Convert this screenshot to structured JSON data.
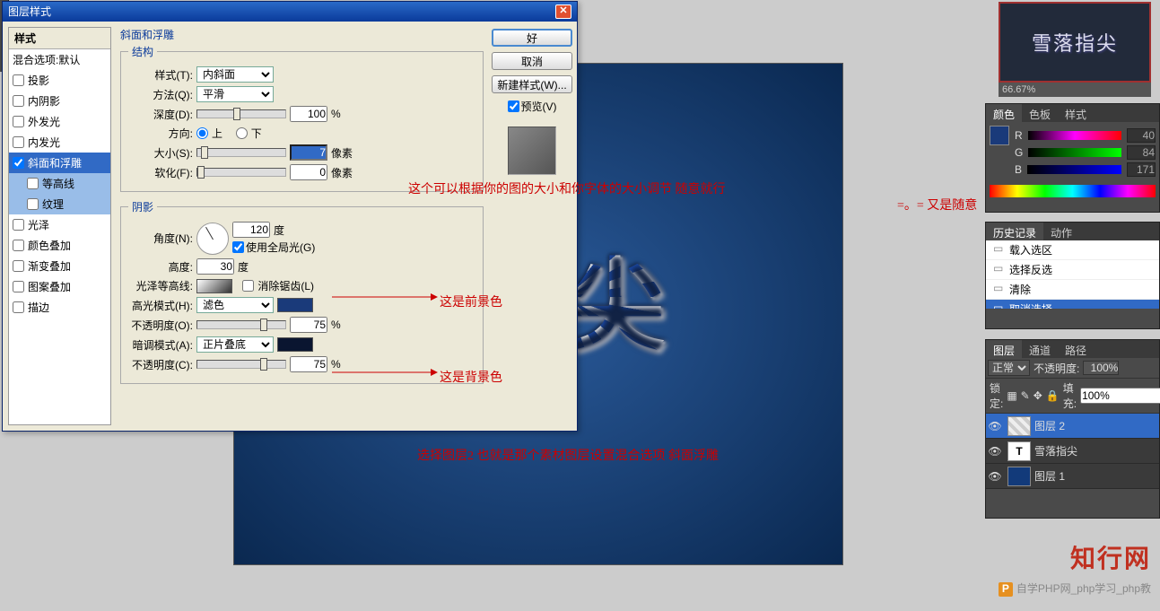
{
  "dialog": {
    "title": "图层样式",
    "ok": "好",
    "cancel": "取消",
    "newStyle": "新建样式(W)...",
    "previewChk": "预览(V)",
    "styles_hdr": "样式",
    "blend_default": "混合选项:默认",
    "list": {
      "shadow": "投影",
      "innerShadow": "内阴影",
      "outerGlow": "外发光",
      "innerGlow": "内发光",
      "bevel": "斜面和浮雕",
      "contour": "等高线",
      "texture": "纹理",
      "satin": "光泽",
      "colorOverlay": "颜色叠加",
      "gradOverlay": "渐变叠加",
      "pattOverlay": "图案叠加",
      "stroke": "描边"
    },
    "section_bevel": "斜面和浮雕",
    "grp_struct": "结构",
    "grp_shade": "阴影",
    "lbl_style": "样式(T):",
    "val_style": "内斜面",
    "lbl_tech": "方法(Q):",
    "val_tech": "平滑",
    "lbl_depth": "深度(D):",
    "val_depth": "100",
    "pct": "%",
    "lbl_dir": "方向:",
    "dir_up": "上",
    "dir_down": "下",
    "lbl_size": "大小(S):",
    "val_size": "7",
    "unit_px": "像素",
    "lbl_soft": "软化(F):",
    "val_soft": "0",
    "lbl_angle": "角度(N):",
    "val_angle": "120",
    "unit_deg": "度",
    "globalLight": "使用全局光(G)",
    "lbl_alt": "高度:",
    "val_alt": "30",
    "lbl_gloss": "光泽等高线:",
    "antiAlias": "消除锯齿(L)",
    "lbl_hiMode": "高光模式(H):",
    "val_hiMode": "滤色",
    "lbl_hiOp": "不透明度(O):",
    "val_hiOp": "75",
    "lbl_shMode": "暗调模式(A):",
    "val_shMode": "正片叠底",
    "lbl_shOp": "不透明度(C):",
    "val_shOp": "75"
  },
  "anno": {
    "a1": "这个可以根据你的图的大小和你字体的大小调节  随意就行",
    "a1b": "=。= 又是随意",
    "a2": "这是前景色",
    "a3": "这是背景色",
    "a4": "选择图层2  也就是那个素材图层设置混合选项  斜面浮雕"
  },
  "canvas_text": "指尖",
  "thumb_text": "雪落指尖",
  "zoom": "66.67%",
  "color": {
    "tab1": "颜色",
    "tab2": "色板",
    "tab3": "样式",
    "r": "R",
    "g": "G",
    "b": "B",
    "rv": "40",
    "gv": "84",
    "bv": "171"
  },
  "hist": {
    "tab1": "历史记录",
    "tab2": "动作",
    "i1": "载入选区",
    "i2": "选择反选",
    "i3": "清除",
    "i4": "取消选择"
  },
  "layers": {
    "tab1": "图层",
    "tab2": "通道",
    "tab3": "路径",
    "blend": "正常",
    "opLabel": "不透明度:",
    "opVal": "100%",
    "lockLbl": "锁定:",
    "fillLbl": "填充:",
    "fillVal": "100%",
    "l1": "图层 2",
    "l2": "雪落指尖",
    "l3": "图层 1"
  },
  "wm1": "知行网",
  "wm2": "自学PHP网_php学习_php教"
}
